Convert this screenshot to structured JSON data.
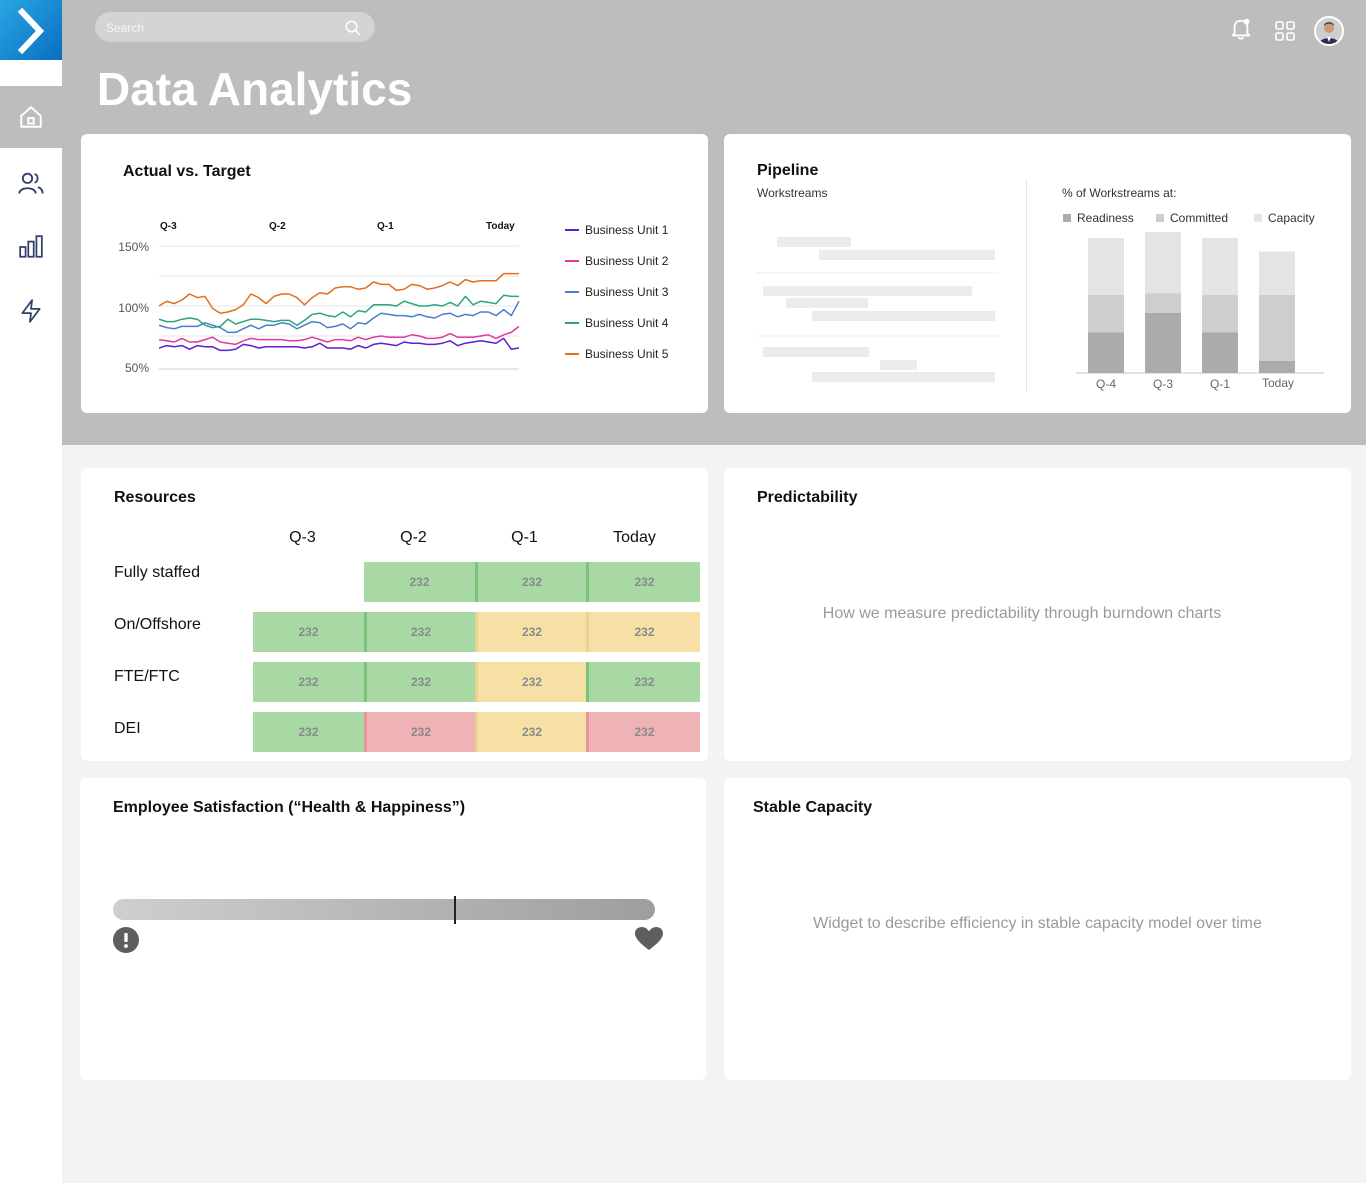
{
  "header": {
    "title": "Data Analytics",
    "search_placeholder": "Search"
  },
  "sidebar": {
    "items": [
      {
        "icon": "home-icon",
        "active": true
      },
      {
        "icon": "users-icon",
        "active": false
      },
      {
        "icon": "bar-chart-icon",
        "active": false
      },
      {
        "icon": "lightning-icon",
        "active": false
      }
    ]
  },
  "actual_vs_target": {
    "title": "Actual vs. Target",
    "quarters": [
      "Q-3",
      "Q-2",
      "Q-1",
      "Today"
    ],
    "y_labels": [
      "150%",
      "100%",
      "50%"
    ],
    "legend": [
      "Business Unit 1",
      "Business Unit 2",
      "Business Unit 3",
      "Business Unit 4",
      "Business Unit 5"
    ]
  },
  "pipeline": {
    "title": "Pipeline",
    "subtitle": "Workstreams",
    "percent_title": "% of Workstreams at:",
    "legend": [
      "Readiness",
      "Committed",
      "Capacity"
    ],
    "bar_labels": [
      "Q-4",
      "Q-3",
      "Q-1",
      "Today"
    ]
  },
  "resources": {
    "title": "Resources",
    "columns": [
      "Q-3",
      "Q-2",
      "Q-1",
      "Today"
    ],
    "rows": [
      {
        "label": "Fully staffed",
        "cells": [
          "",
          "232",
          "232",
          "232"
        ]
      },
      {
        "label": "On/Offshore",
        "cells": [
          "232",
          "232",
          "232",
          "232"
        ]
      },
      {
        "label": "FTE/FTC",
        "cells": [
          "232",
          "232",
          "232",
          "232"
        ]
      },
      {
        "label": "DEI",
        "cells": [
          "232",
          "232",
          "232",
          "232"
        ]
      }
    ]
  },
  "predictability": {
    "title": "Predictability",
    "description": "How we measure predictability through burndown charts"
  },
  "employee_satisfaction": {
    "title": "Employee Satisfaction (“Health & Happiness”)",
    "level": 0.63
  },
  "stable_capacity": {
    "title": "Stable Capacity",
    "description": "Widget to describe efficiency in stable capacity model over time"
  },
  "chart_data": [
    {
      "type": "line",
      "title": "Actual vs. Target",
      "xlabel": "",
      "ylabel": "",
      "ylim": [
        50,
        150
      ],
      "x_ticks": [
        "Q-3",
        "Q-2",
        "Q-1",
        "Today"
      ],
      "series": [
        {
          "name": "Business Unit 1",
          "color": "#5b1fd6",
          "values": [
            65,
            67,
            66,
            67,
            64,
            67,
            66,
            66,
            63,
            63,
            64,
            68,
            67,
            65,
            66,
            66,
            66,
            66,
            66,
            65,
            66,
            69,
            65,
            65,
            65,
            64,
            67,
            65,
            68,
            69,
            68,
            67,
            70,
            69,
            69,
            68,
            68,
            69,
            71,
            67,
            69,
            70,
            71,
            70,
            69,
            73,
            64,
            65
          ]
        },
        {
          "name": "Business Unit 2",
          "color": "#e03aa0",
          "values": [
            72,
            71,
            70,
            73,
            70,
            70,
            72,
            74,
            70,
            69,
            68,
            71,
            73,
            72,
            72,
            72,
            72,
            71,
            71,
            72,
            74,
            72,
            70,
            72,
            72,
            71,
            74,
            72,
            74,
            75,
            74,
            74,
            74,
            76,
            75,
            73,
            73,
            74,
            77,
            74,
            74,
            74,
            75,
            76,
            73,
            76,
            78,
            83
          ]
        },
        {
          "name": "Business Unit 3",
          "color": "#4a7fd0",
          "values": [
            84,
            82,
            81,
            83,
            83,
            83,
            86,
            84,
            82,
            78,
            78,
            81,
            84,
            81,
            84,
            84,
            86,
            85,
            81,
            84,
            87,
            86,
            82,
            83,
            85,
            81,
            86,
            85,
            90,
            94,
            93,
            92,
            92,
            91,
            93,
            91,
            90,
            93,
            94,
            91,
            93,
            92,
            95,
            95,
            92,
            97,
            92,
            104
          ]
        },
        {
          "name": "Business Unit 4",
          "color": "#2fa382",
          "values": [
            89,
            87,
            87,
            89,
            90,
            89,
            84,
            82,
            83,
            89,
            85,
            87,
            89,
            89,
            88,
            87,
            88,
            88,
            84,
            88,
            93,
            94,
            92,
            91,
            95,
            91,
            96,
            95,
            101,
            101,
            101,
            100,
            104,
            102,
            100,
            100,
            101,
            100,
            103,
            100,
            108,
            101,
            104,
            103,
            102,
            109,
            108,
            108
          ]
        },
        {
          "name": "Business Unit 5",
          "color": "#e07020",
          "values": [
            100,
            104,
            102,
            105,
            110,
            107,
            108,
            98,
            94,
            95,
            97,
            101,
            110,
            107,
            102,
            108,
            110,
            110,
            107,
            101,
            107,
            111,
            110,
            115,
            116,
            116,
            114,
            115,
            120,
            118,
            118,
            113,
            114,
            118,
            117,
            114,
            115,
            117,
            120,
            117,
            122,
            120,
            121,
            121,
            121,
            127,
            127,
            127
          ]
        }
      ]
    },
    {
      "type": "bar",
      "title": "% of Workstreams at:",
      "categories": [
        "Q-4",
        "Q-3",
        "Q-1",
        "Today"
      ],
      "ylim": [
        0,
        100
      ],
      "series": [
        {
          "name": "Readiness",
          "color": "#ababab",
          "values": [
            27,
            40,
            27,
            8
          ]
        },
        {
          "name": "Committed",
          "color": "#cecece",
          "values": [
            25,
            13,
            25,
            44
          ]
        },
        {
          "name": "Capacity",
          "color": "#e4e4e4",
          "values": [
            38,
            47,
            38,
            29
          ]
        }
      ]
    }
  ]
}
